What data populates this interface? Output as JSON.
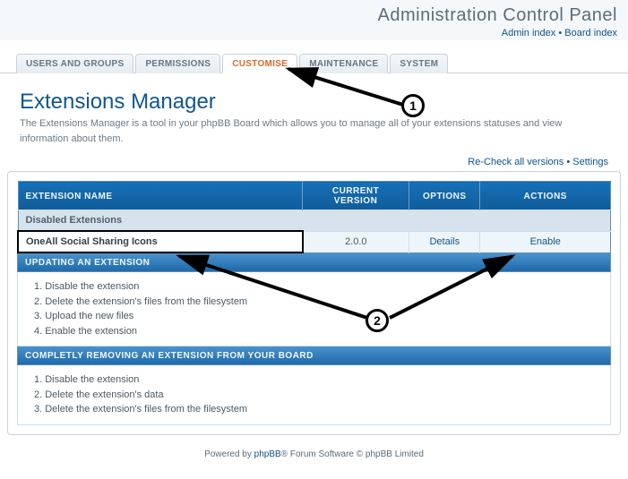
{
  "header": {
    "title": "Administration Control Panel",
    "links": {
      "admin": "Admin index",
      "board": "Board index"
    }
  },
  "tabs": [
    {
      "id": "users",
      "label": "USERS AND GROUPS",
      "active": false
    },
    {
      "id": "permissions",
      "label": "PERMISSIONS",
      "active": false
    },
    {
      "id": "customise",
      "label": "CUSTOMISE",
      "active": true
    },
    {
      "id": "maintenance",
      "label": "MAINTENANCE",
      "active": false
    },
    {
      "id": "system",
      "label": "SYSTEM",
      "active": false
    }
  ],
  "page": {
    "title": "Extensions Manager",
    "desc": "The Extensions Manager is a tool in your phpBB Board which allows you to manage all of your extensions statuses and view information about them."
  },
  "toplinks": {
    "recheck": "Re-Check all versions",
    "settings": "Settings"
  },
  "table": {
    "cols": {
      "name": "EXTENSION NAME",
      "version": "CURRENT VERSION",
      "options": "OPTIONS",
      "actions": "ACTIONS"
    },
    "subhead": "Disabled Extensions",
    "row": {
      "name": "OneAll Social Sharing Icons",
      "version": "2.0.0",
      "details": "Details",
      "enable": "Enable"
    }
  },
  "updating": {
    "title": "UPDATING AN EXTENSION",
    "steps": [
      "Disable the extension",
      "Delete the extension's files from the filesystem",
      "Upload the new files",
      "Enable the extension"
    ]
  },
  "removing": {
    "title": "COMPLETLY REMOVING AN EXTENSION FROM YOUR BOARD",
    "steps": [
      "Disable the extension",
      "Delete the extension's data",
      "Delete the extension's files from the filesystem"
    ]
  },
  "footer": {
    "pre": "Powered by ",
    "link": "phpBB",
    "post": "® Forum Software © phpBB Limited"
  },
  "anno": {
    "c1": "1",
    "c2": "2"
  }
}
